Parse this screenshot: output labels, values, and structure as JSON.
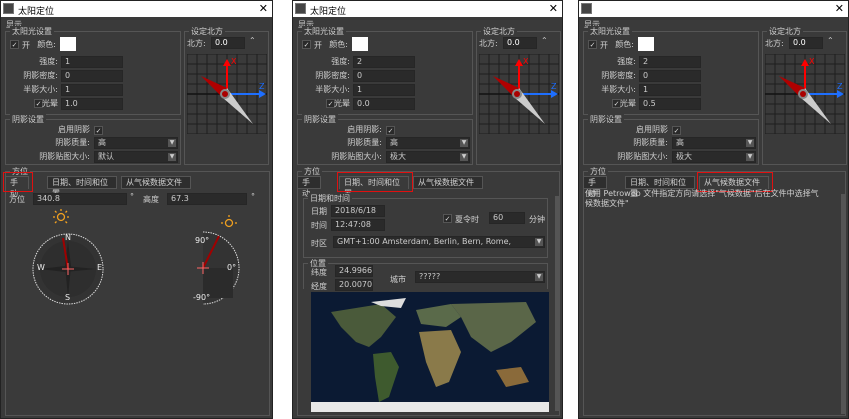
{
  "panels": [
    {
      "title": "太阳定位",
      "display": "显示",
      "light_group": "太阳光设置",
      "on": "开",
      "color": "颜色:",
      "intensity_label": "强度:",
      "intensity": "1",
      "shadow_density_label": "阴影密度:",
      "shadow_density": "0",
      "penumbra_label": "半影大小:",
      "penumbra": "1",
      "glow_label": "光晕",
      "glow": "1.0",
      "shadow_group": "阴影设置",
      "enable_shadow": "启用阴影",
      "shadow_quality_label": "阴影质量:",
      "shadow_quality": "高",
      "shadow_map_label": "阴影贴图大小:",
      "shadow_map": "默认",
      "north_group": "设定北方",
      "north_label": "北方:",
      "north": "0.0",
      "position_group": "方位",
      "tabs": [
        "手动",
        "日期、时间和位置",
        "从气候数据文件"
      ],
      "active_tab": 0
    },
    {
      "title": "太阳定位",
      "display": "显示",
      "light_group": "太阳光设置",
      "on": "开",
      "color": "颜色:",
      "intensity_label": "强度:",
      "intensity": "2",
      "shadow_density_label": "阴影密度:",
      "shadow_density": "0",
      "penumbra_label": "半影大小:",
      "penumbra": "1",
      "glow_label": "光晕",
      "glow": "0.0",
      "shadow_group": "阴影设置",
      "enable_shadow": "启用阴影:",
      "shadow_quality_label": "阴影质量:",
      "shadow_quality": "高",
      "shadow_map_label": "阴影贴图大小:",
      "shadow_map": "极大",
      "north_group": "设定北方",
      "north_label": "北方:",
      "north": "0.0",
      "position_group": "方位",
      "tabs": [
        "手动",
        "日期、时间和位置",
        "从气候数据文件"
      ],
      "active_tab": 1
    },
    {
      "title": "",
      "display": "显示",
      "light_group": "太阳光设置",
      "on": "开",
      "color": "颜色:",
      "intensity_label": "强度:",
      "intensity": "2",
      "shadow_density_label": "阴影密度:",
      "shadow_density": "0",
      "penumbra_label": "半影大小:",
      "penumbra": "1",
      "glow_label": "光晕",
      "glow": "0.5",
      "shadow_group": "阴影设置",
      "enable_shadow": "启用阴影",
      "shadow_quality_label": "阴影质量:",
      "shadow_quality": "高",
      "shadow_map_label": "阴影贴图大小:",
      "shadow_map": "极大",
      "north_group": "设定北方",
      "north_label": "北方:",
      "north": "0.0",
      "position_group": "方位",
      "tabs": [
        "手动",
        "日期、时间和位置",
        "从气候数据文件"
      ],
      "active_tab": 2
    }
  ],
  "manual": {
    "azimuth_label": "方位",
    "azimuth": "340.8",
    "altitude_label": "高度",
    "altitude": "67.3",
    "deg": "°",
    "compass": {
      "n": "N",
      "s": "S",
      "e": "E",
      "w": "W"
    },
    "alt_ticks": [
      "90°",
      "0°",
      "-90°"
    ]
  },
  "datetime": {
    "group": "日期和时间",
    "date_label": "日期",
    "date": "2018/6/18",
    "time_label": "时间",
    "time": "12:47:08",
    "dst_label": "夏令时",
    "dst": "60",
    "dst_unit": "分钟",
    "tz_label": "时区",
    "tz": "GMT+1:00 Amsterdam, Berlin, Bern, Rome, Stockholm, Vi",
    "location_group": "位置",
    "lat_label": "纬度",
    "lat": "24.9966",
    "lon_label": "经度",
    "lon": "20.0070",
    "city_label": "城市",
    "city": "?????"
  },
  "weather": {
    "info": "使用 Petroweb 文件指定方向请选择\"气候数据\"后在文件中选择气候数据文件\""
  },
  "colors": {
    "panel_bg": "#3a3a3a",
    "highlight": "#e01010",
    "sun": "#f0a020",
    "needle": "#a00000"
  }
}
